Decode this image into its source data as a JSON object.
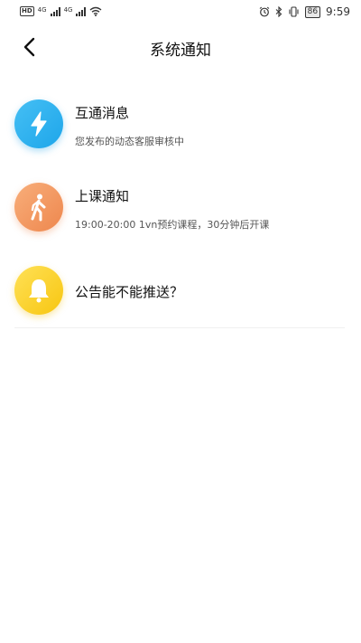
{
  "status_bar": {
    "left": {
      "hd_label": "HD",
      "net1": "4G",
      "net2": "4G"
    },
    "right": {
      "battery": "86",
      "time": "9:59"
    }
  },
  "nav": {
    "title": "系统通知",
    "back_icon": "chevron-left-icon"
  },
  "notifications": [
    {
      "icon": "lightning-icon",
      "color": "#2fb2ef",
      "title": "互通消息",
      "subtitle": "您发布的动态客服审核中"
    },
    {
      "icon": "walking-person-icon",
      "color": "#f39a62",
      "title": "上课通知",
      "subtitle": "19:00-20:00 1vn预约课程，30分钟后开课"
    },
    {
      "icon": "bell-icon",
      "color": "#f9d22d",
      "title": "公告能不能推送？",
      "subtitle": ""
    }
  ]
}
